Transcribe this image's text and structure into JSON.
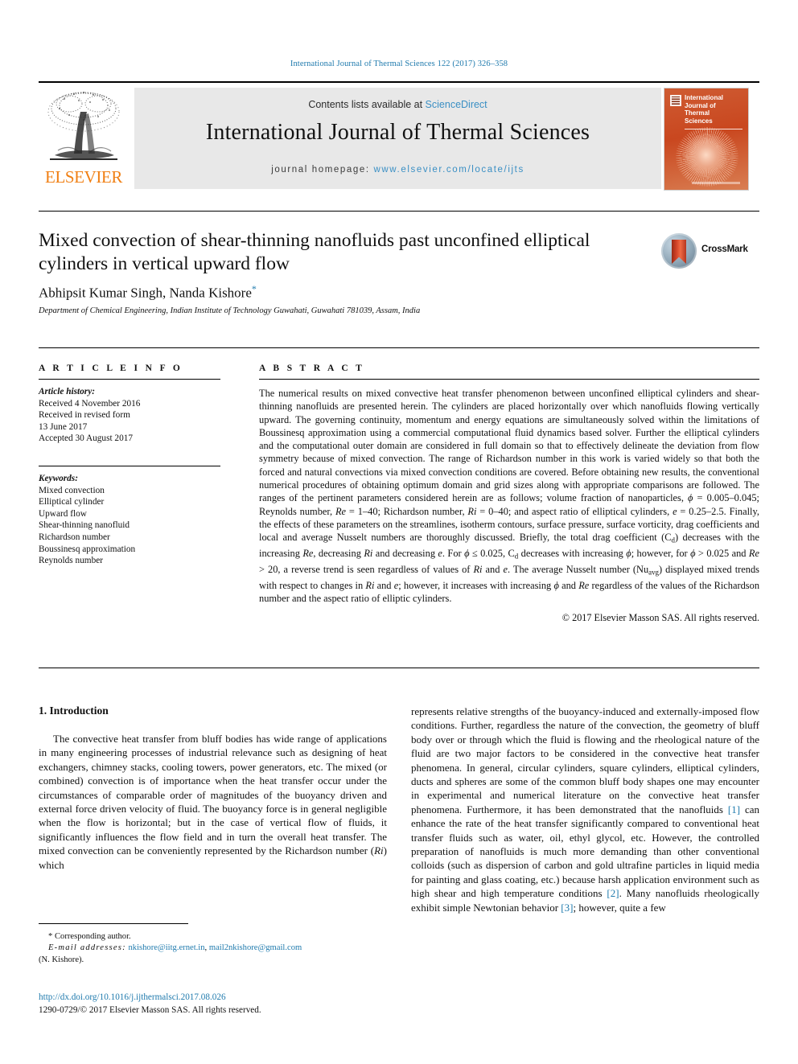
{
  "running_head": "International Journal of Thermal Sciences 122 (2017) 326–358",
  "masthead": {
    "publisher": "ELSEVIER",
    "contents_prefix": "Contents lists available at ",
    "contents_link": "ScienceDirect",
    "journal_name": "International Journal of Thermal Sciences",
    "homepage_label": "journal homepage: ",
    "homepage_url": "www.elsevier.com/locate/ijts",
    "cover": {
      "line1": "International",
      "line2": "Journal of",
      "line3": "Thermal",
      "line4": "Sciences"
    }
  },
  "article": {
    "title": "Mixed convection of shear-thinning nanofluids past unconfined elliptical cylinders in vertical upward flow",
    "authors": "Abhipsit Kumar Singh, Nanda Kishore",
    "corresponding_marker": "*",
    "affiliation": "Department of Chemical Engineering, Indian Institute of Technology Guwahati, Guwahati 781039, Assam, India",
    "crossmark_label": "CrossMark"
  },
  "article_info": {
    "heading": "A R T I C L E  I N F O",
    "history_label": "Article history:",
    "history": [
      "Received 4 November 2016",
      "Received in revised form",
      "13 June 2017",
      "Accepted 30 August 2017"
    ],
    "keywords_label": "Keywords:",
    "keywords": [
      "Mixed convection",
      "Elliptical cylinder",
      "Upward flow",
      "Shear-thinning nanofluid",
      "Richardson number",
      "Boussinesq approximation",
      "Reynolds number"
    ]
  },
  "abstract": {
    "heading": "A B S T R A C T",
    "text_part1": "The numerical results on mixed convective heat transfer phenomenon between unconfined elliptical cylinders and shear-thinning nanofluids are presented herein. The cylinders are placed horizontally over which nanofluids flowing vertically upward. The governing continuity, momentum and energy equations are simultaneously solved within the limitations of Boussinesq approximation using a commercial computational fluid dynamics based solver. Further the elliptical cylinders and the computational outer domain are considered in full domain so that to effectively delineate the deviation from flow symmetry because of mixed convection. The range of Richardson number in this work is varied widely so that both the forced and natural convections via mixed convection conditions are covered. Before obtaining new results, the conventional numerical procedures of obtaining optimum domain and grid sizes along with appropriate comparisons are followed. The ranges of the pertinent parameters considered herein are as follows; volume fraction of nanoparticles, ",
    "phi_sym": "ϕ",
    "phi_range": " = 0.005–0.045; Reynolds number, ",
    "re_sym": "Re",
    "re_range": " = 1–40; Richardson number, ",
    "ri_sym": "Ri",
    "ri_range": " = 0–40; and aspect ratio of elliptical cylinders, ",
    "e_sym": "e",
    "e_range": " = 0.25–2.5. Finally, the effects of these parameters on the streamlines, isotherm contours, surface pressure, surface vorticity, drag coefficients and local and average Nusselt numbers are thoroughly discussed. Briefly, the total drag coefficient (C",
    "cd_sub": "d",
    "text_part2": ") decreases with the increasing ",
    "re2": "Re",
    "text_part3": ", decreasing ",
    "ri2": "Ri",
    "text_part4": " and decreasing ",
    "e2": "e",
    "text_part5": ". For ",
    "phi2": "ϕ",
    "text_part6": " ≤ 0.025, C",
    "cd_sub2": "d",
    "text_part7": " decreases with increasing ",
    "phi3": "ϕ",
    "text_part8": "; however, for ",
    "phi4": "ϕ",
    "text_part9": " > 0.025 and ",
    "re3": "Re",
    "text_part10": " > 20, a reverse trend is seen regardless of values of ",
    "ri3": "Ri",
    "text_part11": " and ",
    "e3": "e",
    "text_part12": ". The average Nusselt number (Nu",
    "nu_sub": "avg",
    "text_part13": ") displayed mixed trends with respect to changes in ",
    "ri4": "Ri",
    "text_part14": " and ",
    "e4": "e",
    "text_part15": "; however, it increases with increasing ",
    "phi5": "ϕ",
    "text_part16": " and ",
    "re4": "Re",
    "text_part17": " regardless of the values of the Richardson number and the aspect ratio of elliptic cylinders.",
    "copyright": "© 2017 Elsevier Masson SAS. All rights reserved."
  },
  "introduction": {
    "heading": "1. Introduction",
    "left_paragraph": "The convective heat transfer from bluff bodies has wide range of applications in many engineering processes of industrial relevance such as designing of heat exchangers, chimney stacks, cooling towers, power generators, etc. The mixed (or combined) convection is of importance when the heat transfer occur under the circumstances of comparable order of magnitudes of the buoyancy driven and external force driven velocity of fluid. The buoyancy force is in general negligible when the flow is horizontal; but in the case of vertical flow of fluids, it significantly influences the flow field and in turn the overall heat transfer. The mixed convection can be conveniently represented by the Richardson number (",
    "ri_italic": "Ri",
    "left_paragraph_end": ") which",
    "right_part1": "represents relative strengths of the buoyancy-induced and externally-imposed flow conditions. Further, regardless the nature of the convection, the geometry of bluff body over or through which the fluid is flowing and the rheological nature of the fluid are two major factors to be considered in the convective heat transfer phenomena. In general, circular cylinders, square cylinders, elliptical cylinders, ducts and spheres are some of the common bluff body shapes one may encounter in experimental and numerical literature on the convective heat transfer phenomena. Furthermore, it has been demonstrated that the nanofluids ",
    "cite1": "[1]",
    "right_part2": " can enhance the rate of the heat transfer significantly compared to conventional heat transfer fluids such as water, oil, ethyl glycol, etc. However, the controlled preparation of nanofluids is much more demanding than other conventional colloids (such as dispersion of carbon and gold ultrafine particles in liquid media for painting and glass coating, etc.) because harsh application environment such as high shear and high temperature conditions ",
    "cite2": "[2]",
    "right_part3": ". Many nanofluids rheologically exhibit simple Newtonian behavior ",
    "cite3": "[3]",
    "right_part4": "; however, quite a few"
  },
  "footer": {
    "corresponding_marker": "*",
    "corresponding_label": "Corresponding author.",
    "email_label": "E-mail addresses:",
    "email1": "nkishore@iitg.ernet.in",
    "email_sep": ",",
    "email2": "mail2nkishore@gmail.com",
    "email_owner": "(N. Kishore).",
    "doi": "http://dx.doi.org/10.1016/j.ijthermalsci.2017.08.026",
    "issn_line": "1290-0729/© 2017 Elsevier Masson SAS. All rights reserved."
  },
  "colors": {
    "link": "#1f7aad",
    "sciencedirect": "#3a8fc4",
    "elsevier_orange": "#f07f13",
    "band_gray": "#e8e8e8"
  }
}
